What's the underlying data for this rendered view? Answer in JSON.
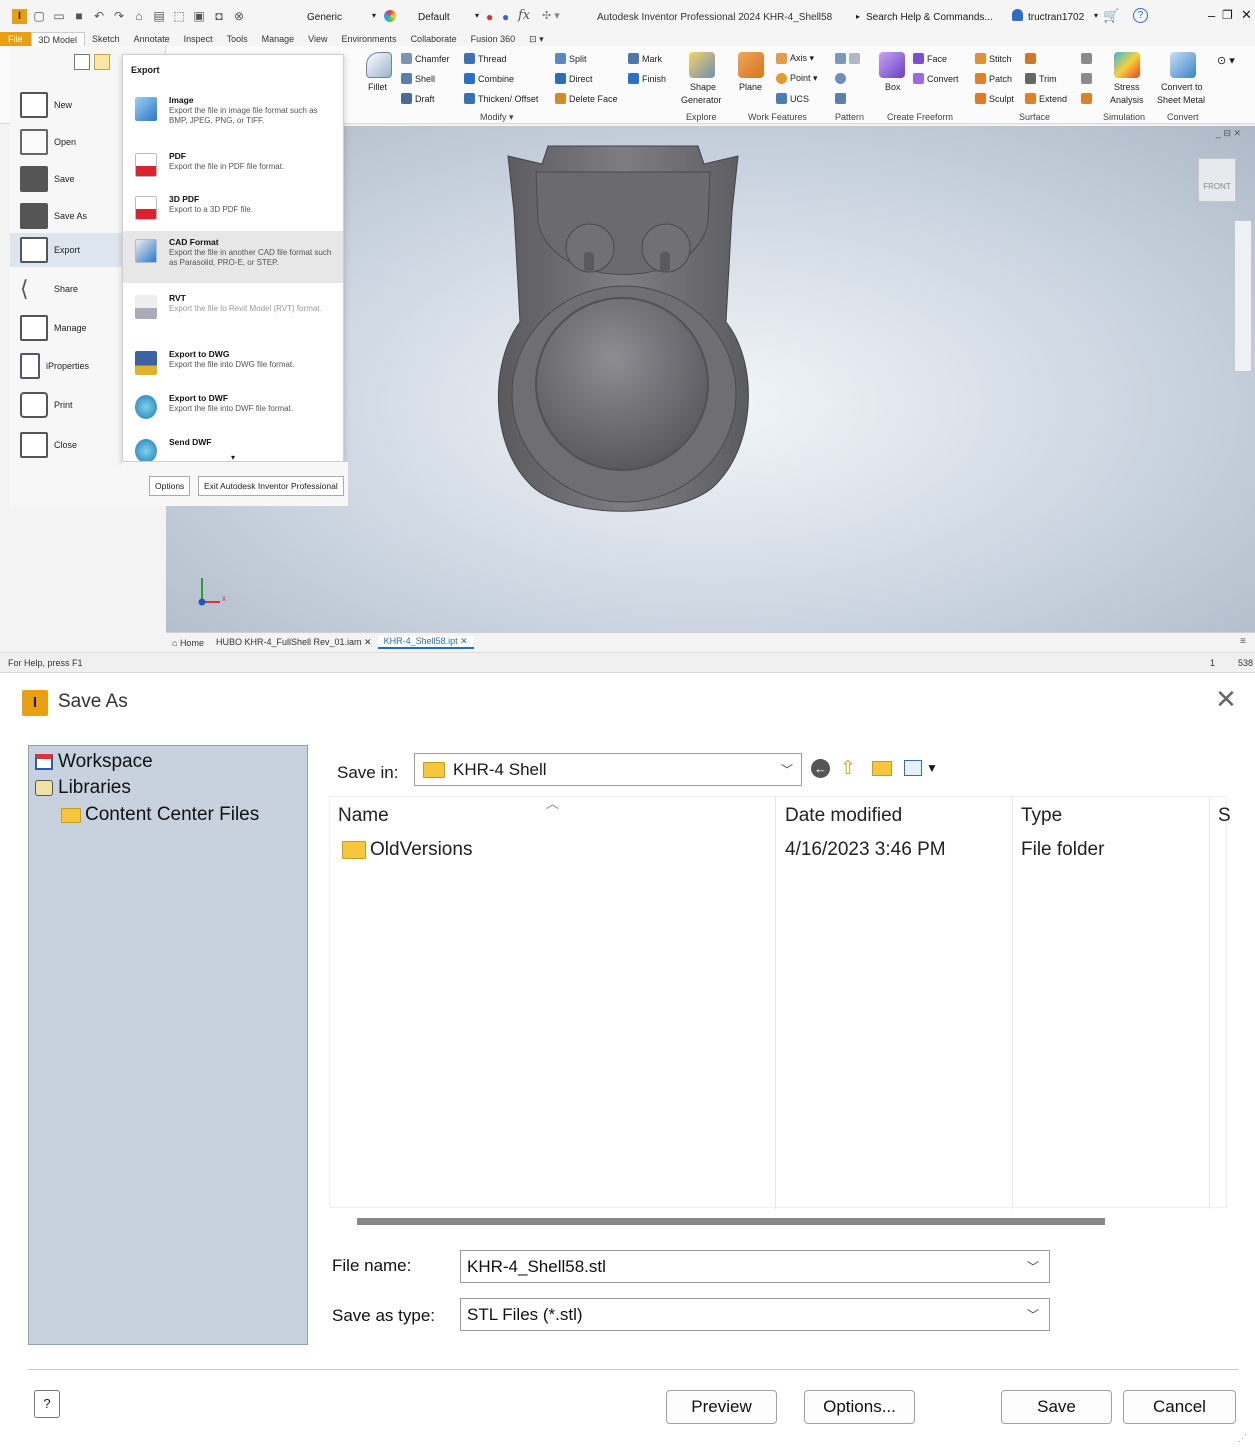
{
  "app": {
    "qat_style": "Generic",
    "qat_appearance": "Default",
    "title": "Autodesk Inventor Professional 2024   KHR-4_Shell58",
    "search_placeholder": "Search Help & Commands...",
    "user": "tructran1702",
    "tabs": [
      "File",
      "3D Model",
      "Sketch",
      "Annotate",
      "Inspect",
      "Tools",
      "Manage",
      "View",
      "Environments",
      "Collaborate",
      "Fusion 360"
    ],
    "ribbon": {
      "fillet": "Fillet",
      "modify": {
        "chamfer": "Chamfer",
        "shell": "Shell",
        "draft": "Draft",
        "thread": "Thread",
        "combine": "Combine",
        "thicken": "Thicken/ Offset",
        "split": "Split",
        "direct": "Direct",
        "delete_face": "Delete Face",
        "mark": "Mark",
        "finish": "Finish",
        "label": "Modify ▾"
      },
      "explore": {
        "shape_generator_1": "Shape",
        "shape_generator_2": "Generator",
        "label": "Explore"
      },
      "work": {
        "plane": "Plane",
        "axis": "Axis ▾",
        "point": "Point ▾",
        "ucs": "UCS",
        "label": "Work Features"
      },
      "pattern": {
        "label": "Pattern"
      },
      "freeform": {
        "box": "Box",
        "face": "Face",
        "convert": "Convert",
        "label": "Create Freeform"
      },
      "surface": {
        "stitch": "Stitch",
        "patch": "Patch",
        "sculpt": "Sculpt",
        "trim": "Trim",
        "extend": "Extend",
        "label": "Surface"
      },
      "simulation": {
        "l1": "Stress",
        "l2": "Analysis",
        "label": "Simulation"
      },
      "convert": {
        "l1": "Convert to",
        "l2": "Sheet Metal",
        "label": "Convert"
      }
    },
    "viewcube": "FRONT",
    "doc_tabs": {
      "home": "Home",
      "assembly": "HUBO KHR-4_FullShell Rev_01.iam",
      "part": "KHR-4_Shell58.ipt"
    },
    "status": {
      "help": "For Help, press F1",
      "n1": "1",
      "n2": "538"
    },
    "axis_x": "x",
    "file_menu": [
      "New",
      "Open",
      "Save",
      "Save As",
      "Export",
      "Share",
      "Manage",
      "iProperties",
      "Print",
      "Close"
    ],
    "export_panel": {
      "heading": "Export",
      "items": [
        {
          "title": "Image",
          "desc": "Export the file in image file format such as BMP, JPEG, PNG, or TIFF."
        },
        {
          "title": "PDF",
          "desc": "Export the file in PDF file format."
        },
        {
          "title": "3D PDF",
          "desc": "Export to a 3D PDF file."
        },
        {
          "title": "CAD Format",
          "desc": "Export the file in another CAD file format such as Parasolid, PRO-E, or STEP."
        },
        {
          "title": "RVT",
          "desc": "Export the file to Revit Model (RVT) format."
        },
        {
          "title": "Export to DWG",
          "desc": "Export the file into DWG file format."
        },
        {
          "title": "Export to DWF",
          "desc": "Export the file into DWF file format."
        },
        {
          "title": "Send DWF",
          "desc": ""
        }
      ],
      "options": "Options",
      "exit": "Exit Autodesk Inventor Professional"
    }
  },
  "dialog": {
    "title": "Save As",
    "places": [
      "Workspace",
      "Libraries",
      "Content Center Files"
    ],
    "save_in_label": "Save in:",
    "save_in_value": "KHR-4 Shell",
    "columns": {
      "name": "Name",
      "date": "Date modified",
      "type": "Type",
      "size": "S"
    },
    "rows": [
      {
        "name": "OldVersions",
        "date": "4/16/2023 3:46 PM",
        "type": "File folder"
      }
    ],
    "file_name_label": "File name:",
    "file_name_value": "KHR-4_Shell58.stl",
    "save_type_label": "Save as type:",
    "save_type_value": "STL Files (*.stl)",
    "buttons": {
      "preview": "Preview",
      "options": "Options...",
      "save": "Save",
      "cancel": "Cancel"
    },
    "help": "?"
  }
}
